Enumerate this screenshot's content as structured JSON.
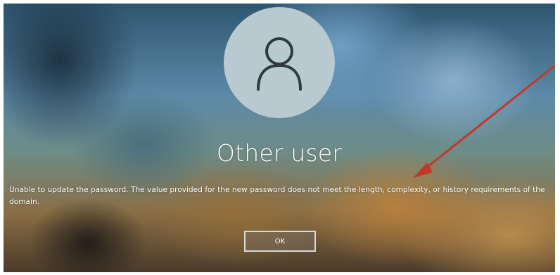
{
  "login": {
    "username": "Other user",
    "message": "Unable to update the password. The value provided for the new password does not meet the length, complexity, or history requirements of the domain.",
    "ok_label": "OK"
  },
  "icons": {
    "avatar": "user-silhouette-icon"
  },
  "colors": {
    "avatar_bg": "#b9c9d0",
    "avatar_glyph": "#2f3a40",
    "annotation_arrow": "#c0392b",
    "text": "#ffffff"
  }
}
